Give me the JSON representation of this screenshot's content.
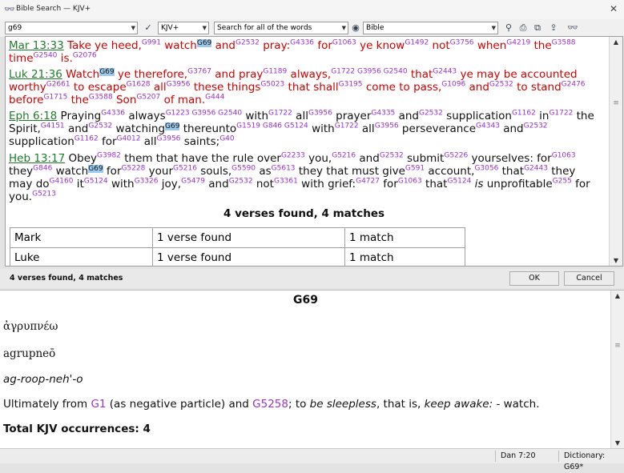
{
  "window": {
    "title": "Bible Search — KJV+"
  },
  "toolbar": {
    "search_text": "g69",
    "version": "KJV+",
    "search_mode": "Search for all of the words",
    "scope": "Bible"
  },
  "results": {
    "summary": "4 verses found, 4 matches",
    "table": [
      {
        "book": "Mark",
        "verses": "1 verse found",
        "matches": "1 match"
      },
      {
        "book": "Luke",
        "verses": "1 verse found",
        "matches": "1 match"
      }
    ]
  },
  "status": {
    "text": "4 verses found, 4 matches"
  },
  "buttons": {
    "ok": "OK",
    "cancel": "Cancel"
  },
  "dictionary": {
    "heading": "G69",
    "greek": "ἀγρυπνέω",
    "translit": "agrupneō",
    "pronunciation": "ag-roop-neh'-o",
    "definition": {
      "p1": "Ultimately from ",
      "link1": "G1",
      "p2": " (as negative particle) and ",
      "link2": "G5258",
      "p3": "; to ",
      "i1": "be sleepless",
      "p4": ", that is, ",
      "i2": "keep awake:",
      "p5": " - watch."
    },
    "total": "Total KJV occurrences: 4"
  },
  "statusbar": {
    "reference": "Dan 7:20",
    "dictionary": "Dictionary: G69*"
  }
}
